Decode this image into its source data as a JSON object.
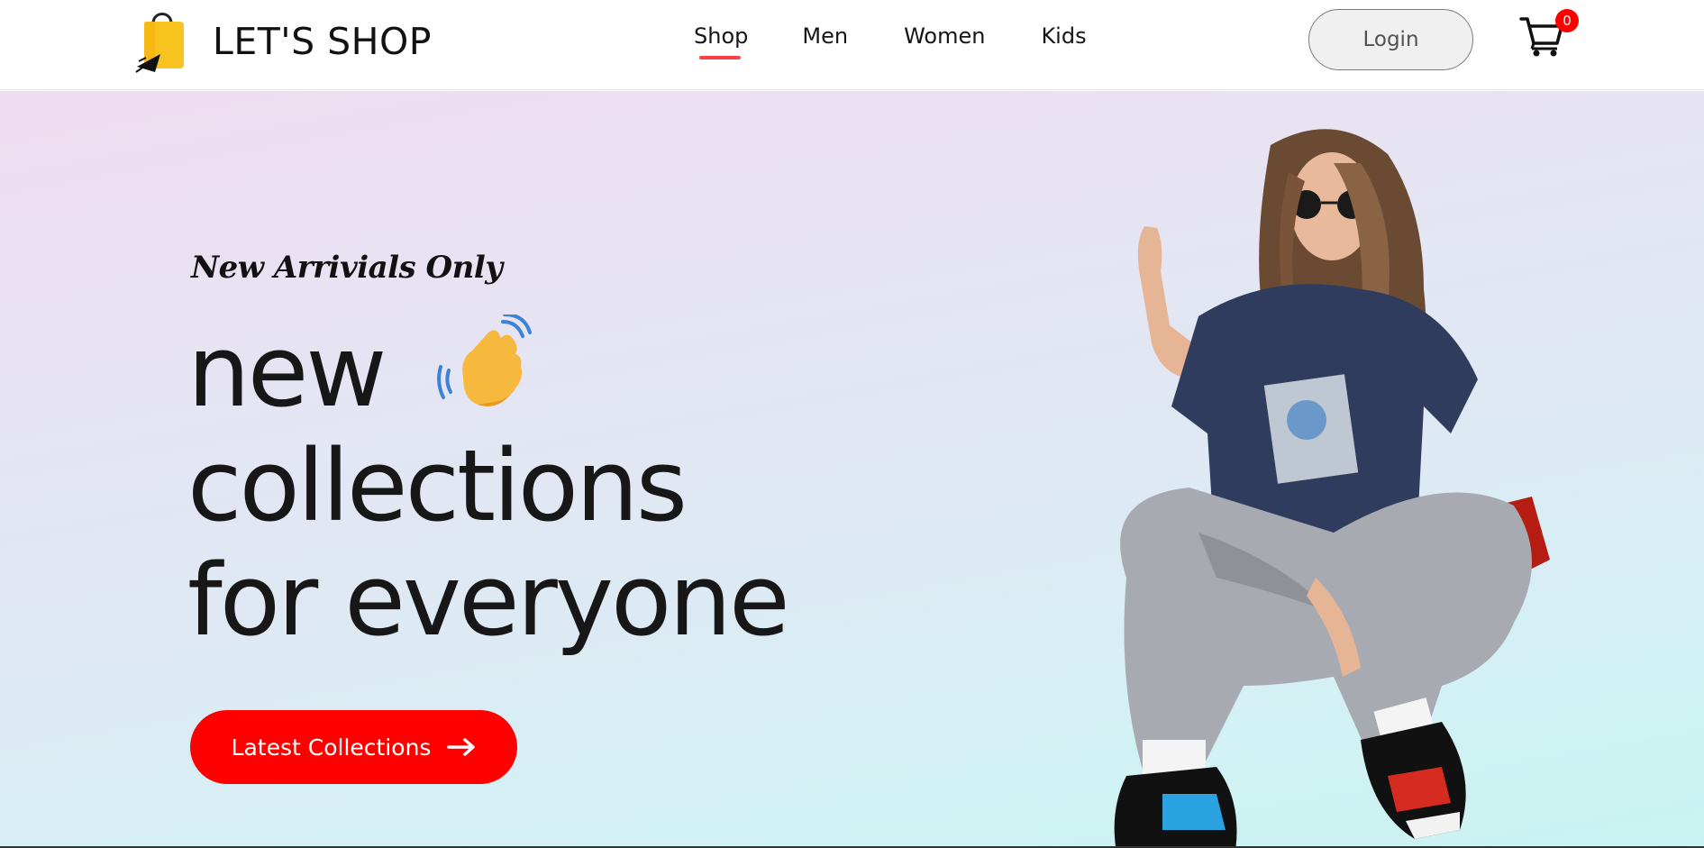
{
  "brand": {
    "name": "LET'S SHOP",
    "logo_icon": "shopping-bag-cursor-icon",
    "accent_color": "#ff4141"
  },
  "nav": {
    "items": [
      {
        "label": "Shop",
        "active": true
      },
      {
        "label": "Men",
        "active": false
      },
      {
        "label": "Women",
        "active": false
      },
      {
        "label": "Kids",
        "active": false
      }
    ],
    "login_label": "Login",
    "cart_icon": "shopping-cart-icon",
    "cart_count": "0"
  },
  "hero": {
    "tag": "New Arrivials Only",
    "headline": [
      "new",
      "collections",
      "for everyone"
    ],
    "wave_icon": "waving-hand-icon",
    "cta_label": "Latest Collections",
    "cta_icon": "arrow-right-icon",
    "cta_color": "#ff0000"
  }
}
